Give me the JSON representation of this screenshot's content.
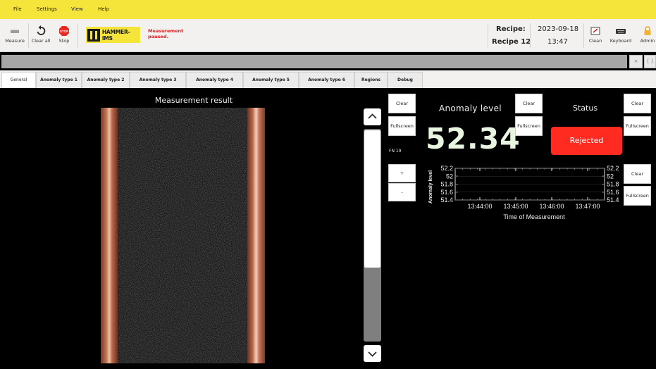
{
  "menu": {
    "items": [
      "File",
      "Settings",
      "View",
      "Help"
    ]
  },
  "toolbar": {
    "measure_label": "Measure",
    "clear_all_label": "Clear all",
    "stop_label": "Stop",
    "stop_icon_text": "STOP",
    "logo_text": "HAMMER-IMS",
    "status_text": "Measurement paused.",
    "recipe_label": "Recipe:",
    "recipe_value": "Recipe 12",
    "date": "2023-09-18",
    "time": "13:47",
    "clean_label": "Clean",
    "keyboard_label": "Keyboard",
    "admin_label": "Admin"
  },
  "window_buttons": {
    "close": "×",
    "restore": "[ ]"
  },
  "tabs": [
    {
      "label": "General",
      "active": true
    },
    {
      "label": "Anomaly type 1"
    },
    {
      "label": "Anomaly type 2"
    },
    {
      "label": "Anomaly type 3"
    },
    {
      "label": "Anomaly type 4"
    },
    {
      "label": "Anomaly type 5"
    },
    {
      "label": "Anomaly type 6"
    },
    {
      "label": "Regions"
    },
    {
      "label": "Debug"
    }
  ],
  "measurement": {
    "title": "Measurement result"
  },
  "controls": {
    "clear": "Clear",
    "fullscreen": "Fullscreen",
    "fn_label": "FN 19",
    "plus": "+",
    "minus": "-"
  },
  "anomaly": {
    "label": "Anomaly level",
    "value": "52.34"
  },
  "status": {
    "label": "Status",
    "value": "Rejected",
    "color": "#ff2a20"
  },
  "chart_data": {
    "type": "line",
    "title": "",
    "xlabel": "Time of Measurement",
    "ylabel": "Anomaly level",
    "x_ticks": [
      "13:44:00",
      "13:45:00",
      "13:46:00",
      "13:47:00"
    ],
    "y_ticks": [
      "52.2",
      "52",
      "51.8",
      "51.6",
      "51.4"
    ],
    "ylim": [
      51.4,
      52.2
    ],
    "grid": true,
    "series": []
  },
  "colors": {
    "accent": "#f5e43a",
    "alert": "#e02020",
    "background": "#000000"
  }
}
